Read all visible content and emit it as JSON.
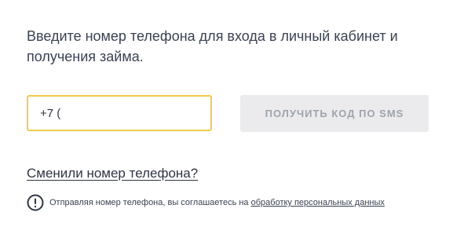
{
  "intro": {
    "text": "Введите номер телефона для входа в личный кабинет и получения займа."
  },
  "phone": {
    "value": "+7 ("
  },
  "sms_button": {
    "label": "ПОЛУЧИТЬ КОД ПО SMS"
  },
  "change_phone": {
    "label": "Сменили номер телефона?"
  },
  "notice": {
    "icon": "info-icon",
    "text": "Отправляя номер телефона, вы соглашаетесь на ",
    "link_label": "обработку персональных данных"
  },
  "colors": {
    "input_border": "#f2c94c",
    "button_bg": "#ebebed",
    "button_text": "#9ea3ac",
    "text": "#3b4252"
  }
}
